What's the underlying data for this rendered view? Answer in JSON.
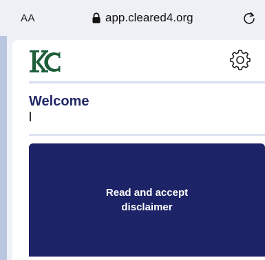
{
  "browser": {
    "text_size_label": "AA",
    "url": "app.cleared4.org",
    "lock_icon": "lock-icon",
    "reload_icon": "reload-icon"
  },
  "header": {
    "logo_icon": "kc-logo-icon",
    "settings_icon": "gear-icon",
    "logo_color": "#1f5e3a"
  },
  "main": {
    "welcome_title": "Welcome",
    "disclaimer_button_label": "Read and accept disclaimer",
    "accent_color": "#1c2366"
  }
}
